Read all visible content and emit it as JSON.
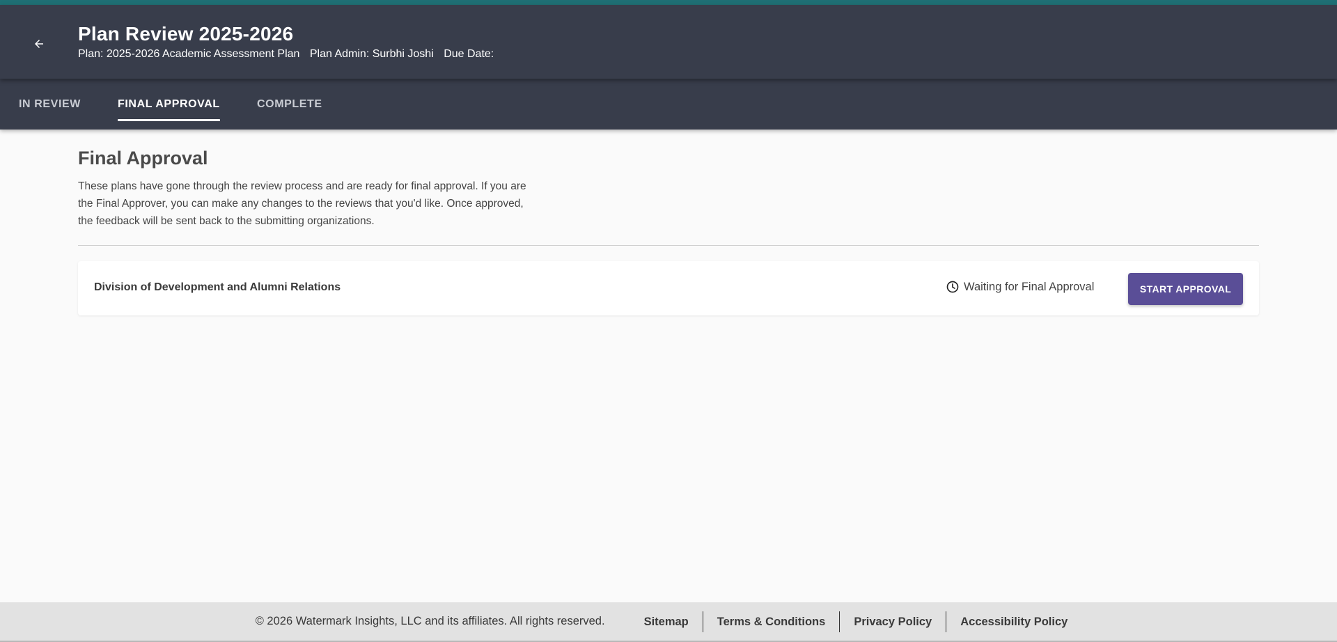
{
  "header": {
    "title": "Plan Review 2025-2026",
    "plan": "Plan: 2025-2026 Academic Assessment Plan",
    "admin": "Plan Admin: Surbhi Joshi",
    "due_date": "Due Date:",
    "back_icon": "arrow-left-icon"
  },
  "tabs": [
    {
      "label": "IN REVIEW",
      "active": false
    },
    {
      "label": "FINAL APPROVAL",
      "active": true
    },
    {
      "label": "COMPLETE",
      "active": false
    }
  ],
  "main": {
    "title": "Final Approval",
    "description": "These plans have gone through the review process and are ready for final approval. If you are the Final Approver, you can make any changes to the reviews that you'd like. Once approved, the feedback will be sent back to the submitting organizations.",
    "items": [
      {
        "name": "Division of Development and Alumni Relations",
        "status": "Waiting for Final Approval",
        "status_icon": "clock-icon",
        "action_label": "START APPROVAL"
      }
    ]
  },
  "footer": {
    "copyright": "© 2026 Watermark Insights, LLC and its affiliates. All rights reserved.",
    "links": [
      "Sitemap",
      "Terms & Conditions",
      "Privacy Policy",
      "Accessibility Policy"
    ]
  },
  "colors": {
    "header_bg": "#383d4b",
    "accent_bar": "#1f6f74",
    "primary_button": "#5a4e97",
    "footer_bg": "#e2e2e2"
  }
}
